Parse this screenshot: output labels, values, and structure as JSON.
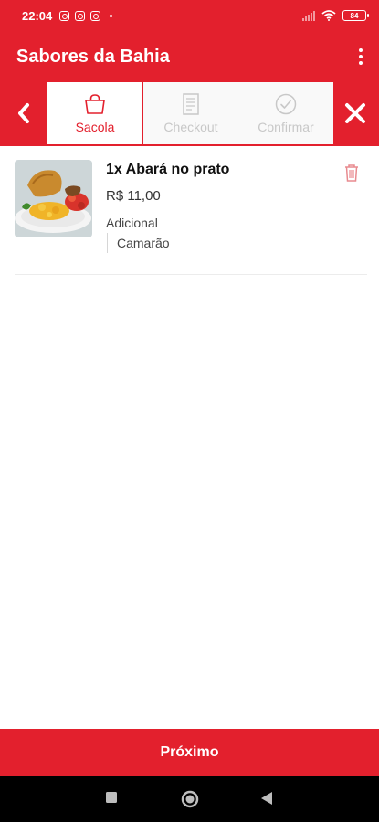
{
  "status_bar": {
    "time": "22:04",
    "battery": "84"
  },
  "app_bar": {
    "title": "Sabores da Bahia"
  },
  "steps": [
    {
      "label": "Sacola",
      "state": "active",
      "icon": "bag-icon"
    },
    {
      "label": "Checkout",
      "state": "inactive",
      "icon": "document-icon"
    },
    {
      "label": "Confirmar",
      "state": "inactive",
      "icon": "check-circle-icon"
    }
  ],
  "cart": {
    "items": [
      {
        "name": "1x Abará no prato",
        "price": "R$ 11,00",
        "addon_title": "Adicional",
        "addons": [
          "Camarão"
        ]
      }
    ]
  },
  "footer": {
    "next_label": "Próximo"
  },
  "colors": {
    "primary": "#e3202d",
    "inactive": "#c8c8c8",
    "nav_bar": "#000000"
  }
}
